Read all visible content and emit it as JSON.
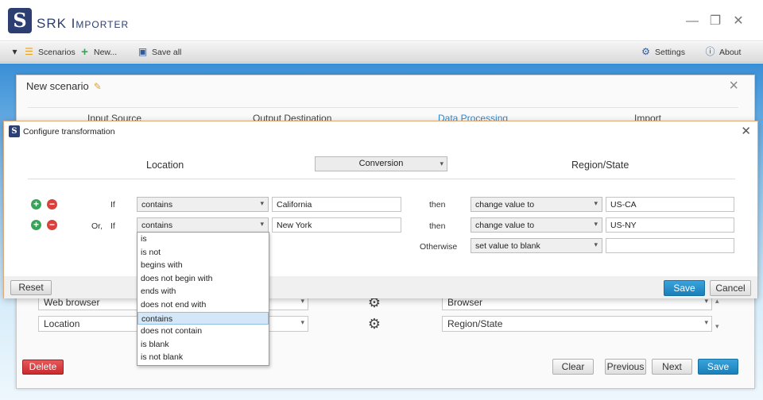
{
  "app": {
    "logo_letter": "S",
    "title": "SRK Importer"
  },
  "window_controls": {
    "minimize": "—",
    "maximize": "❐",
    "close": "✕"
  },
  "toolbar": {
    "scenarios": "Scenarios",
    "new": "New...",
    "save_all": "Save all",
    "settings": "Settings",
    "about": "About"
  },
  "scenario": {
    "title": "New scenario",
    "steps": [
      "Input Source",
      "Output Destination",
      "Data Processing",
      "Import"
    ],
    "active_step": "Data Processing",
    "mappings": [
      {
        "source": "Web browser",
        "target": "Browser"
      },
      {
        "source": "Location",
        "target": "Region/State"
      }
    ],
    "buttons": {
      "delete": "Delete",
      "clear": "Clear",
      "previous": "Previous",
      "next": "Next",
      "save": "Save"
    }
  },
  "dialog": {
    "title": "Configure transformation",
    "source_column": "Location",
    "transformation": "Conversion",
    "target_column": "Region/State",
    "rules": [
      {
        "prefix": "",
        "if_label": "If",
        "operator": "contains",
        "value": "California",
        "then_label": "then",
        "action": "change value to",
        "result": "US-CA"
      },
      {
        "prefix": "Or,",
        "if_label": "If",
        "operator": "contains",
        "value": "New York",
        "then_label": "then",
        "action": "change value to",
        "result": "US-NY"
      }
    ],
    "otherwise": {
      "label": "Otherwise",
      "action": "set value to blank",
      "result": ""
    },
    "buttons": {
      "reset": "Reset",
      "save": "Save",
      "cancel": "Cancel"
    }
  },
  "operator_dropdown": {
    "options": [
      "is",
      "is not",
      "begins with",
      "does not begin with",
      "ends with",
      "does not end with",
      "contains",
      "does not contain",
      "is blank",
      "is not blank"
    ],
    "selected": "contains"
  },
  "colors": {
    "accent": "#2a8ad0",
    "brand": "#2c3e72",
    "delete": "#d9413d",
    "add": "#3aa35a"
  }
}
